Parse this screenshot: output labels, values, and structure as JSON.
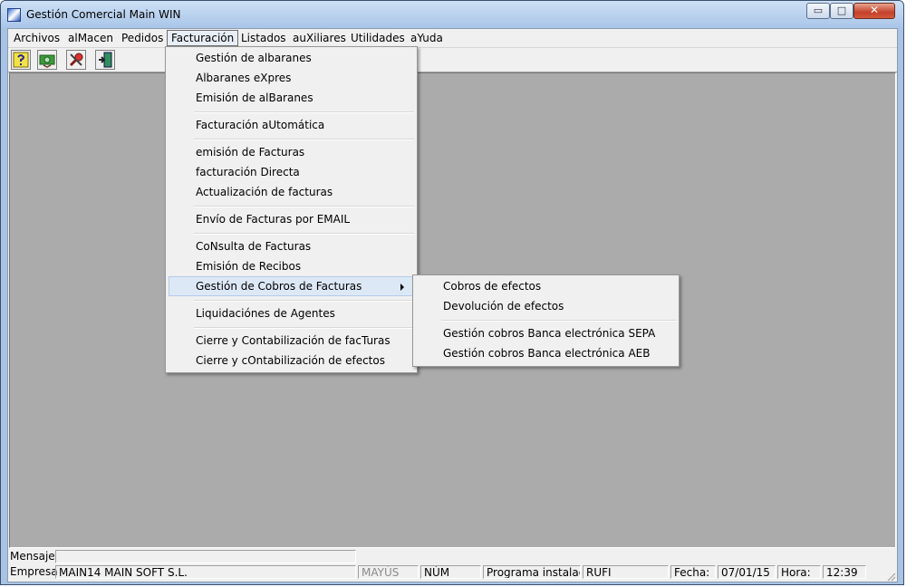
{
  "window": {
    "title": "Gestión Comercial Main WIN"
  },
  "window_buttons": {
    "minimize": "▭",
    "maximize": "□",
    "close": "✕"
  },
  "menu": {
    "items": [
      "Archivos",
      "alMacen",
      "Pedidos",
      "Facturación",
      "Listados",
      "auXiliares",
      "Utilidades",
      "aYuda"
    ],
    "active": "Facturación"
  },
  "toolbar": {
    "buttons": [
      {
        "icon": "help-wizard-icon"
      },
      {
        "icon": "money-icon"
      },
      {
        "icon": "tools-icon"
      },
      {
        "icon": "exit-door-icon"
      }
    ]
  },
  "facturacion_menu": {
    "items": [
      "Gestión de albaranes",
      "Albaranes eXpres",
      "Emisión de alBaranes",
      "Facturación aUtomática",
      "emisión de Facturas",
      "facturación Directa",
      "Actualización de facturas",
      "Envío de Facturas por EMAIL",
      "CoNsulta de Facturas",
      "Emisión de Recibos",
      "Gestión de Cobros de Facturas",
      "Liquidaciónes de Agentes",
      "Cierre y Contabilización de facTuras",
      "Cierre y cOntabilización de efectos"
    ],
    "highlighted": "Gestión de Cobros de Facturas"
  },
  "cobros_submenu": {
    "items": [
      "Cobros de efectos",
      "Devolución de efectos",
      "Gestión cobros Banca electrónica SEPA",
      "Gestión cobros Banca electrónica AEB"
    ]
  },
  "status": {
    "mensaje_label": "Mensaje",
    "mensaje_value": "",
    "empresa_label": "Empresa",
    "empresa_value": "MAIN14  MAIN SOFT  S.L.",
    "mayus": "MAYÚS",
    "num": "NÚM",
    "programa_label": "Programa instalado",
    "programa_value": "RUFI",
    "fecha_label": "Fecha:",
    "fecha_value": "07/01/15",
    "hora_label": "Hora:",
    "hora_value": "12:39"
  },
  "colors": {
    "mdi_background": "#ababab",
    "frame": "#a9c3e4",
    "menu_highlight": "#dde8f7",
    "close_button": "#c4412a"
  }
}
